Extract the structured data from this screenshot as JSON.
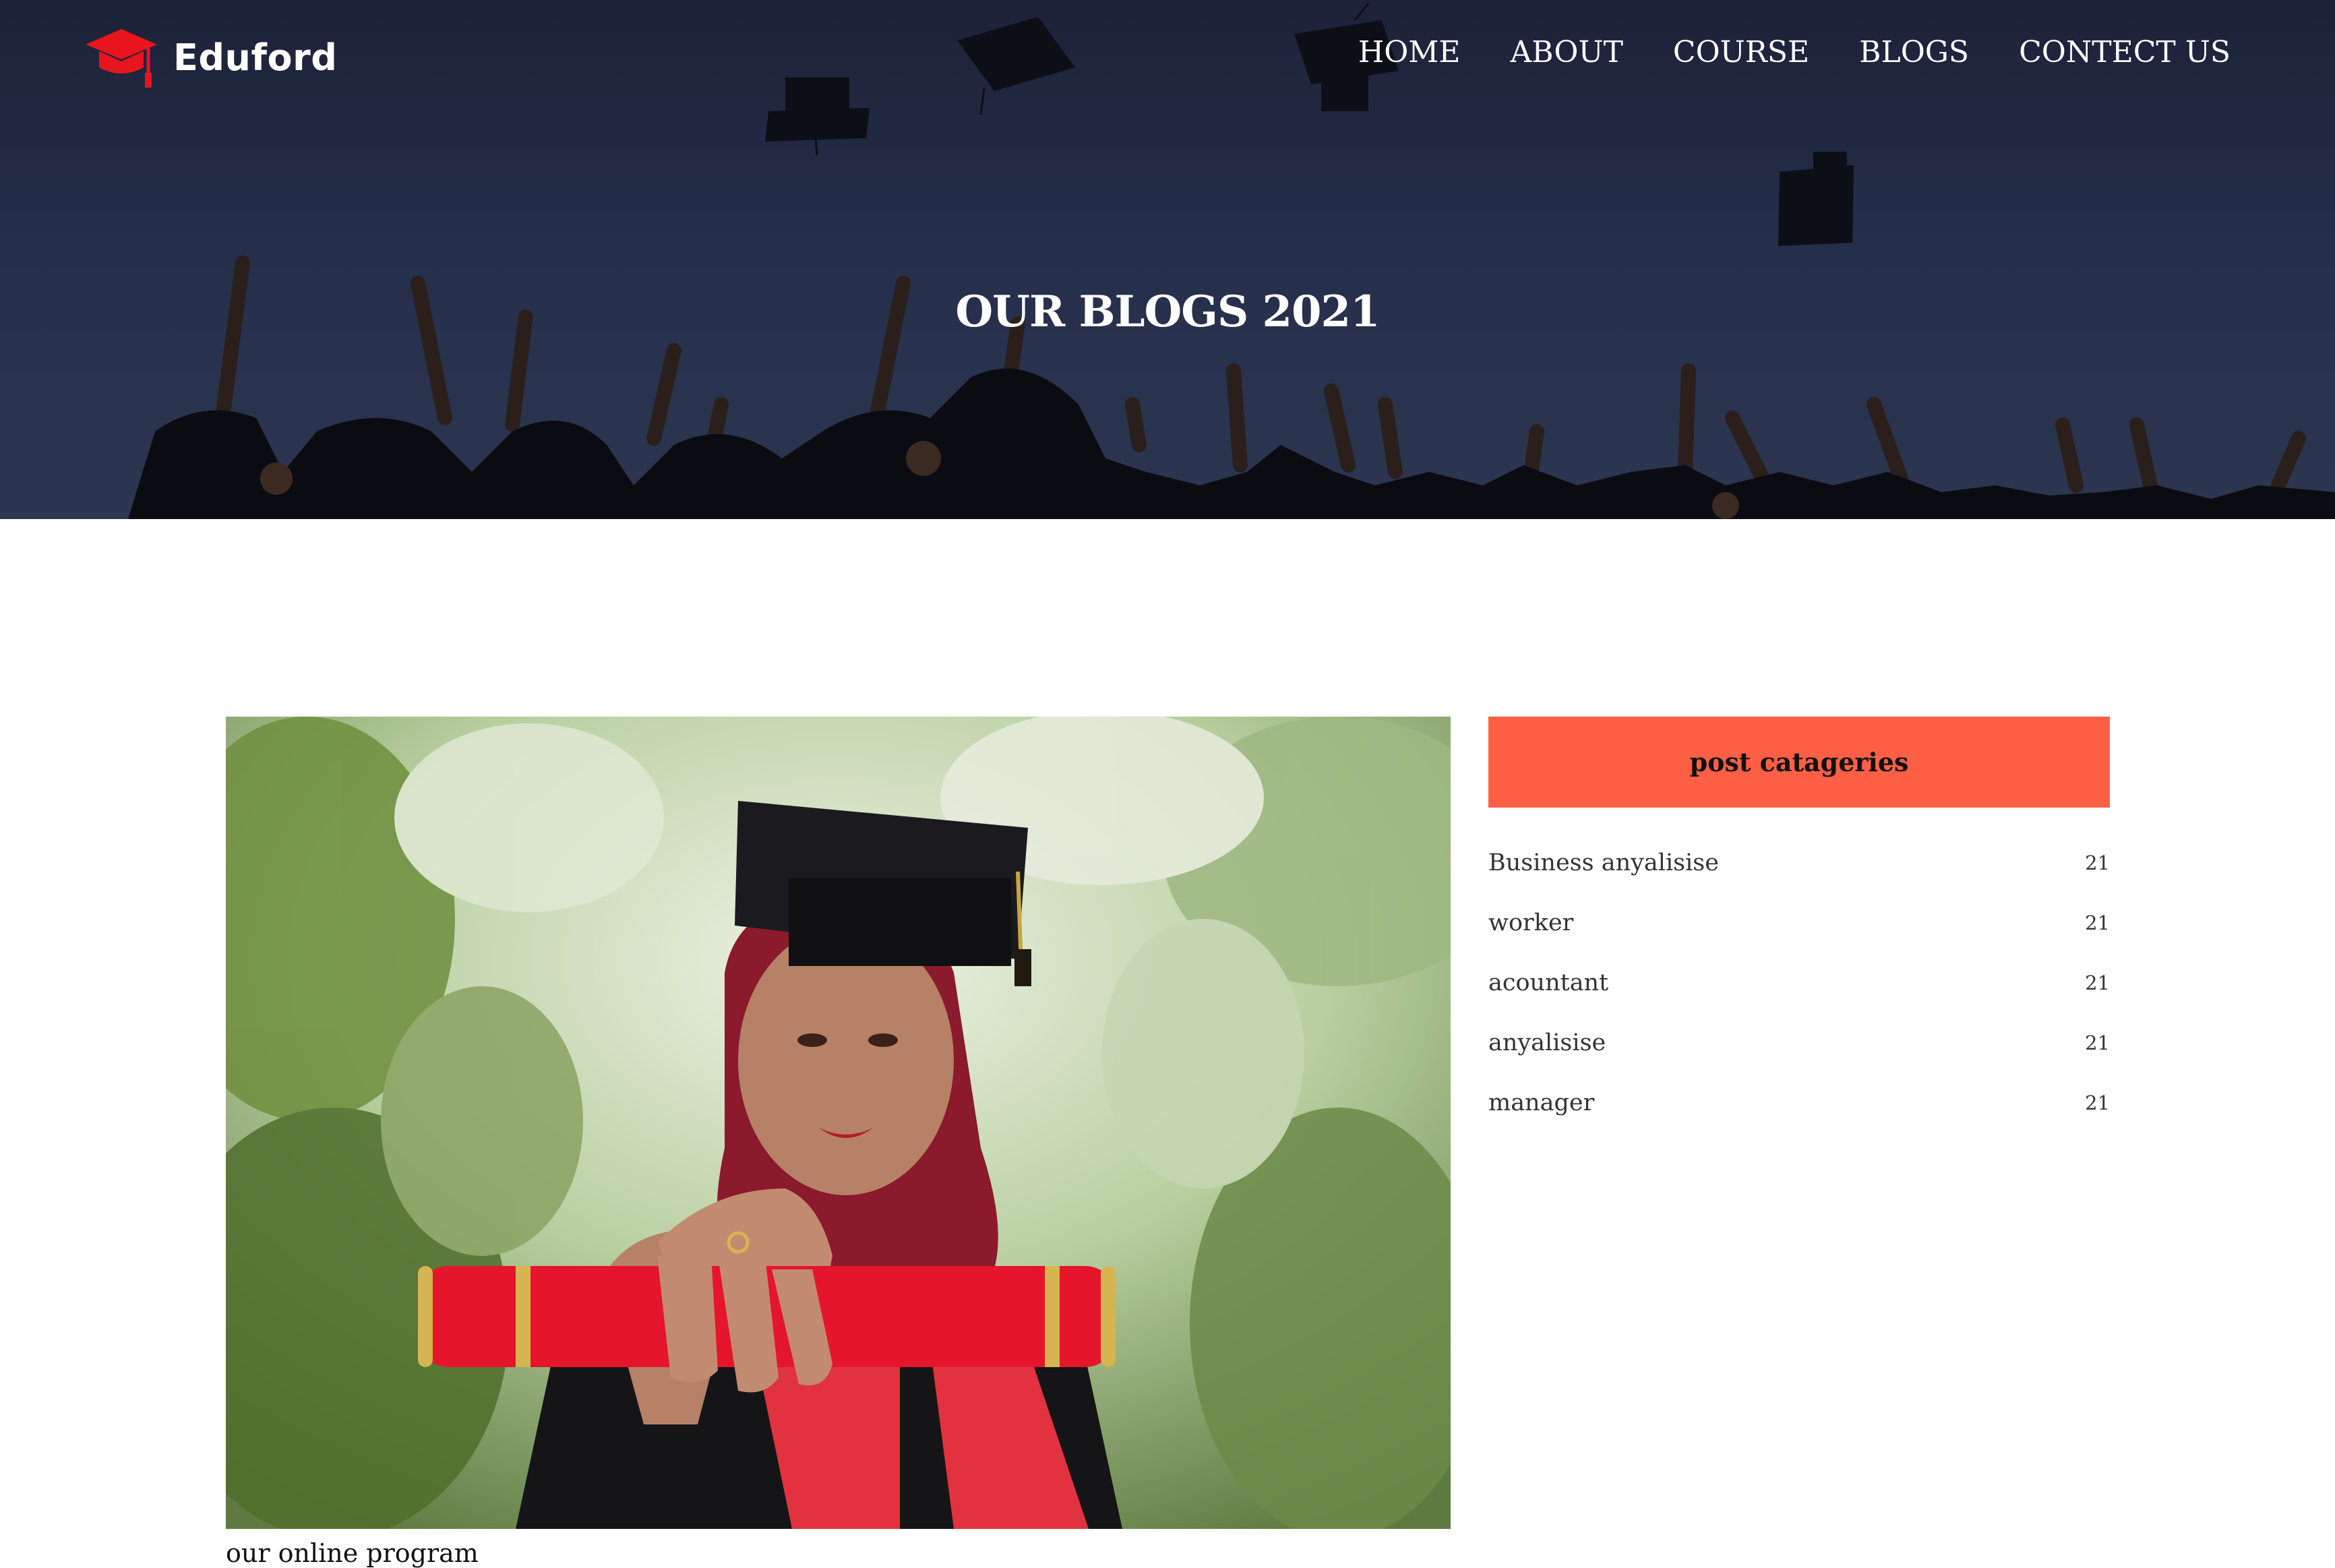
{
  "brand": {
    "name": "Eduford",
    "icon": "graduation-cap-icon",
    "icon_color": "#e8141e"
  },
  "nav": {
    "items": [
      {
        "label": "HOME"
      },
      {
        "label": "ABOUT"
      },
      {
        "label": "COURSE"
      },
      {
        "label": "BLOGS"
      },
      {
        "label": "CONTECT US"
      }
    ]
  },
  "hero": {
    "title": "OUR BLOGS 2021"
  },
  "post": {
    "caption": "our online program"
  },
  "sidebar": {
    "header": "post catageries",
    "header_color": "#ff5f45",
    "categories": [
      {
        "name": "Business anyalisise",
        "count": "21"
      },
      {
        "name": "worker",
        "count": "21"
      },
      {
        "name": "acountant",
        "count": "21"
      },
      {
        "name": "anyalisise",
        "count": "21"
      },
      {
        "name": "manager",
        "count": "21"
      }
    ]
  }
}
